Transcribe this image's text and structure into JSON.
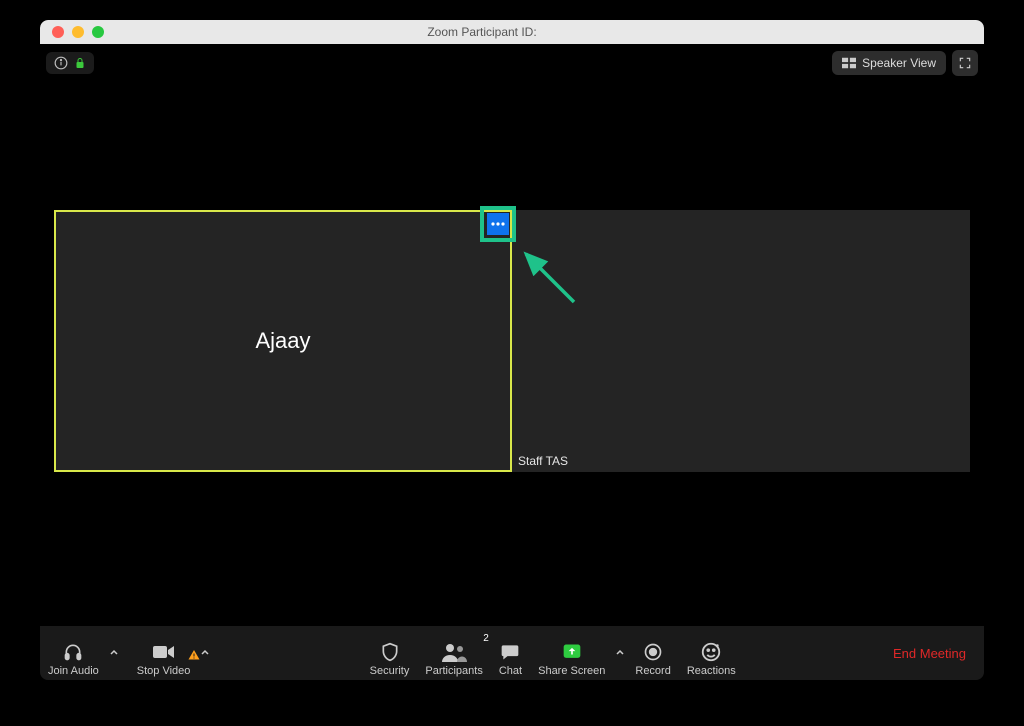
{
  "window": {
    "title_prefix": "Zoom Participant ID:"
  },
  "topbar": {
    "speaker_view_label": "Speaker View"
  },
  "participants": {
    "left_name": "Ajaay",
    "right_name": "Staff TAS"
  },
  "toolbar": {
    "join_audio": "Join Audio",
    "stop_video": "Stop Video",
    "security": "Security",
    "participants": "Participants",
    "participants_count": "2",
    "chat": "Chat",
    "share_screen": "Share Screen",
    "record": "Record",
    "reactions": "Reactions",
    "end_meeting": "End Meeting"
  },
  "more_btn_glyph": "…"
}
